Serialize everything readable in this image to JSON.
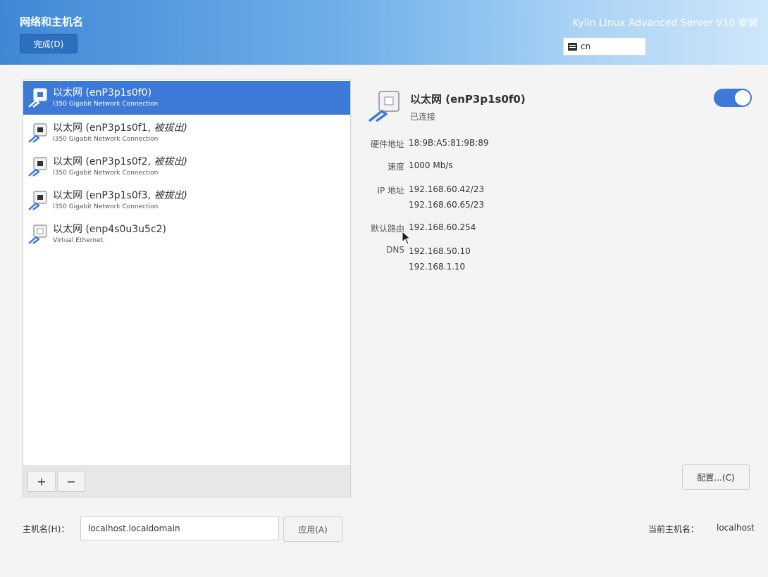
{
  "header": {
    "title": "网络和主机名",
    "done_label": "完成(D)",
    "product": "Kylin Linux Advanced Server V10 安装",
    "keyboard_layout": "cn"
  },
  "devices": [
    {
      "name": "以太网 (enP3p1s0f0)",
      "suffix": "",
      "subtitle": "I350 Gigabit Network Connection",
      "selected": true
    },
    {
      "name": "以太网 (enP3p1s0f1, ",
      "suffix": "被拔出)",
      "subtitle": "I350 Gigabit Network Connection",
      "selected": false
    },
    {
      "name": "以太网 (enP3p1s0f2, ",
      "suffix": "被拔出)",
      "subtitle": "I350 Gigabit Network Connection",
      "selected": false
    },
    {
      "name": "以太网 (enP3p1s0f3, ",
      "suffix": "被拔出)",
      "subtitle": "I350 Gigabit Network Connection",
      "selected": false
    },
    {
      "name": "以太网 (enp4s0u3u5c2)",
      "suffix": "",
      "subtitle": "Virtual Ethernet.",
      "selected": false
    }
  ],
  "toolbar": {
    "add_label": "+",
    "remove_label": "−"
  },
  "detail": {
    "name": "以太网 (enP3p1s0f0)",
    "status": "已连接",
    "enabled": true,
    "hw_label": "硬件地址",
    "hw_value": "18:9B:A5:81:9B:89",
    "speed_label": "速度",
    "speed_value": "1000 Mb/s",
    "ip_label": "IP 地址",
    "ip_values": [
      "192.168.60.42/23",
      "192.168.60.65/23"
    ],
    "route_label": "默认路由",
    "route_value": "192.168.60.254",
    "dns_label": "DNS",
    "dns_values": [
      "192.168.50.10",
      "192.168.1.10"
    ],
    "config_label": "配置...(C)"
  },
  "hostname": {
    "label": "主机名(H)：",
    "value": "localhost.localdomain",
    "apply_label": "应用(A)",
    "current_label": "当前主机名：",
    "current_value": "localhost"
  },
  "colors": {
    "accent": "#3d79d6",
    "header_start": "#3f88d4",
    "header_end": "#cfe6fa"
  }
}
